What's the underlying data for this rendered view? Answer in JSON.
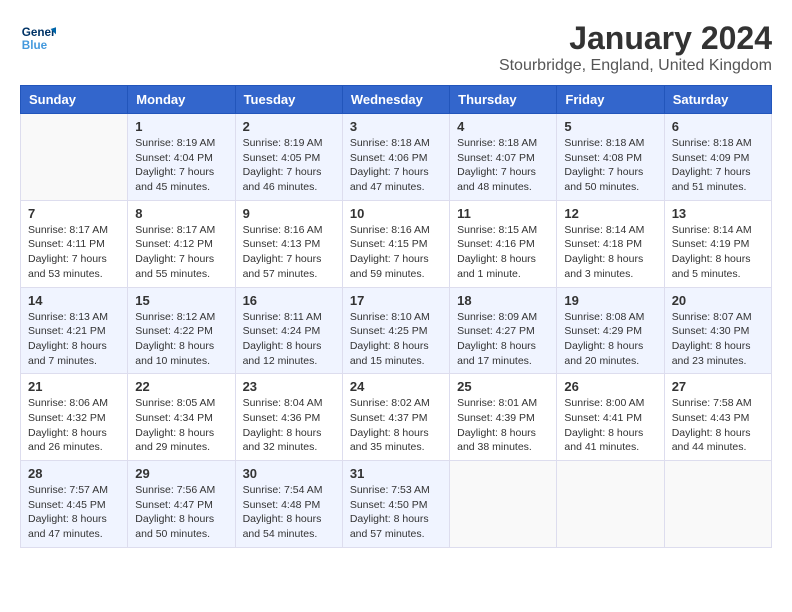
{
  "header": {
    "logo_line1": "General",
    "logo_line2": "Blue",
    "month_title": "January 2024",
    "location": "Stourbridge, England, United Kingdom"
  },
  "days_of_week": [
    "Sunday",
    "Monday",
    "Tuesday",
    "Wednesday",
    "Thursday",
    "Friday",
    "Saturday"
  ],
  "weeks": [
    [
      {
        "day": "",
        "sunrise": "",
        "sunset": "",
        "daylight": ""
      },
      {
        "day": "1",
        "sunrise": "Sunrise: 8:19 AM",
        "sunset": "Sunset: 4:04 PM",
        "daylight": "Daylight: 7 hours and 45 minutes."
      },
      {
        "day": "2",
        "sunrise": "Sunrise: 8:19 AM",
        "sunset": "Sunset: 4:05 PM",
        "daylight": "Daylight: 7 hours and 46 minutes."
      },
      {
        "day": "3",
        "sunrise": "Sunrise: 8:18 AM",
        "sunset": "Sunset: 4:06 PM",
        "daylight": "Daylight: 7 hours and 47 minutes."
      },
      {
        "day": "4",
        "sunrise": "Sunrise: 8:18 AM",
        "sunset": "Sunset: 4:07 PM",
        "daylight": "Daylight: 7 hours and 48 minutes."
      },
      {
        "day": "5",
        "sunrise": "Sunrise: 8:18 AM",
        "sunset": "Sunset: 4:08 PM",
        "daylight": "Daylight: 7 hours and 50 minutes."
      },
      {
        "day": "6",
        "sunrise": "Sunrise: 8:18 AM",
        "sunset": "Sunset: 4:09 PM",
        "daylight": "Daylight: 7 hours and 51 minutes."
      }
    ],
    [
      {
        "day": "7",
        "sunrise": "Sunrise: 8:17 AM",
        "sunset": "Sunset: 4:11 PM",
        "daylight": "Daylight: 7 hours and 53 minutes."
      },
      {
        "day": "8",
        "sunrise": "Sunrise: 8:17 AM",
        "sunset": "Sunset: 4:12 PM",
        "daylight": "Daylight: 7 hours and 55 minutes."
      },
      {
        "day": "9",
        "sunrise": "Sunrise: 8:16 AM",
        "sunset": "Sunset: 4:13 PM",
        "daylight": "Daylight: 7 hours and 57 minutes."
      },
      {
        "day": "10",
        "sunrise": "Sunrise: 8:16 AM",
        "sunset": "Sunset: 4:15 PM",
        "daylight": "Daylight: 7 hours and 59 minutes."
      },
      {
        "day": "11",
        "sunrise": "Sunrise: 8:15 AM",
        "sunset": "Sunset: 4:16 PM",
        "daylight": "Daylight: 8 hours and 1 minute."
      },
      {
        "day": "12",
        "sunrise": "Sunrise: 8:14 AM",
        "sunset": "Sunset: 4:18 PM",
        "daylight": "Daylight: 8 hours and 3 minutes."
      },
      {
        "day": "13",
        "sunrise": "Sunrise: 8:14 AM",
        "sunset": "Sunset: 4:19 PM",
        "daylight": "Daylight: 8 hours and 5 minutes."
      }
    ],
    [
      {
        "day": "14",
        "sunrise": "Sunrise: 8:13 AM",
        "sunset": "Sunset: 4:21 PM",
        "daylight": "Daylight: 8 hours and 7 minutes."
      },
      {
        "day": "15",
        "sunrise": "Sunrise: 8:12 AM",
        "sunset": "Sunset: 4:22 PM",
        "daylight": "Daylight: 8 hours and 10 minutes."
      },
      {
        "day": "16",
        "sunrise": "Sunrise: 8:11 AM",
        "sunset": "Sunset: 4:24 PM",
        "daylight": "Daylight: 8 hours and 12 minutes."
      },
      {
        "day": "17",
        "sunrise": "Sunrise: 8:10 AM",
        "sunset": "Sunset: 4:25 PM",
        "daylight": "Daylight: 8 hours and 15 minutes."
      },
      {
        "day": "18",
        "sunrise": "Sunrise: 8:09 AM",
        "sunset": "Sunset: 4:27 PM",
        "daylight": "Daylight: 8 hours and 17 minutes."
      },
      {
        "day": "19",
        "sunrise": "Sunrise: 8:08 AM",
        "sunset": "Sunset: 4:29 PM",
        "daylight": "Daylight: 8 hours and 20 minutes."
      },
      {
        "day": "20",
        "sunrise": "Sunrise: 8:07 AM",
        "sunset": "Sunset: 4:30 PM",
        "daylight": "Daylight: 8 hours and 23 minutes."
      }
    ],
    [
      {
        "day": "21",
        "sunrise": "Sunrise: 8:06 AM",
        "sunset": "Sunset: 4:32 PM",
        "daylight": "Daylight: 8 hours and 26 minutes."
      },
      {
        "day": "22",
        "sunrise": "Sunrise: 8:05 AM",
        "sunset": "Sunset: 4:34 PM",
        "daylight": "Daylight: 8 hours and 29 minutes."
      },
      {
        "day": "23",
        "sunrise": "Sunrise: 8:04 AM",
        "sunset": "Sunset: 4:36 PM",
        "daylight": "Daylight: 8 hours and 32 minutes."
      },
      {
        "day": "24",
        "sunrise": "Sunrise: 8:02 AM",
        "sunset": "Sunset: 4:37 PM",
        "daylight": "Daylight: 8 hours and 35 minutes."
      },
      {
        "day": "25",
        "sunrise": "Sunrise: 8:01 AM",
        "sunset": "Sunset: 4:39 PM",
        "daylight": "Daylight: 8 hours and 38 minutes."
      },
      {
        "day": "26",
        "sunrise": "Sunrise: 8:00 AM",
        "sunset": "Sunset: 4:41 PM",
        "daylight": "Daylight: 8 hours and 41 minutes."
      },
      {
        "day": "27",
        "sunrise": "Sunrise: 7:58 AM",
        "sunset": "Sunset: 4:43 PM",
        "daylight": "Daylight: 8 hours and 44 minutes."
      }
    ],
    [
      {
        "day": "28",
        "sunrise": "Sunrise: 7:57 AM",
        "sunset": "Sunset: 4:45 PM",
        "daylight": "Daylight: 8 hours and 47 minutes."
      },
      {
        "day": "29",
        "sunrise": "Sunrise: 7:56 AM",
        "sunset": "Sunset: 4:47 PM",
        "daylight": "Daylight: 8 hours and 50 minutes."
      },
      {
        "day": "30",
        "sunrise": "Sunrise: 7:54 AM",
        "sunset": "Sunset: 4:48 PM",
        "daylight": "Daylight: 8 hours and 54 minutes."
      },
      {
        "day": "31",
        "sunrise": "Sunrise: 7:53 AM",
        "sunset": "Sunset: 4:50 PM",
        "daylight": "Daylight: 8 hours and 57 minutes."
      },
      {
        "day": "",
        "sunrise": "",
        "sunset": "",
        "daylight": ""
      },
      {
        "day": "",
        "sunrise": "",
        "sunset": "",
        "daylight": ""
      },
      {
        "day": "",
        "sunrise": "",
        "sunset": "",
        "daylight": ""
      }
    ]
  ]
}
